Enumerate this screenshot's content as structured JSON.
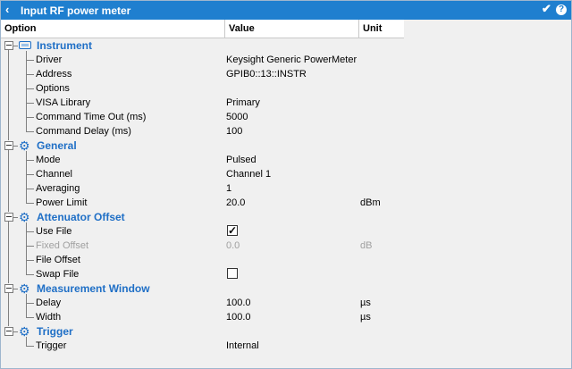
{
  "window": {
    "title": "Input RF power meter"
  },
  "columns": {
    "option": "Option",
    "value": "Value",
    "unit": "Unit"
  },
  "groups": [
    {
      "name": "Instrument",
      "icon": "instrument-icon",
      "rows": [
        {
          "label": "Driver",
          "value": "Keysight Generic PowerMeter",
          "unit": ""
        },
        {
          "label": "Address",
          "value": "GPIB0::13::INSTR",
          "unit": ""
        },
        {
          "label": "Options",
          "value": "",
          "unit": ""
        },
        {
          "label": "VISA Library",
          "value": "Primary",
          "unit": ""
        },
        {
          "label": "Command Time Out (ms)",
          "value": "5000",
          "unit": ""
        },
        {
          "label": "Command Delay (ms)",
          "value": "100",
          "unit": ""
        }
      ]
    },
    {
      "name": "General",
      "icon": "gear-icon",
      "rows": [
        {
          "label": "Mode",
          "value": "Pulsed",
          "unit": ""
        },
        {
          "label": "Channel",
          "value": "Channel 1",
          "unit": ""
        },
        {
          "label": "Averaging",
          "value": "1",
          "unit": ""
        },
        {
          "label": "Power Limit",
          "value": "20.0",
          "unit": "dBm"
        }
      ]
    },
    {
      "name": "Attenuator Offset",
      "icon": "gear-icon",
      "rows": [
        {
          "label": "Use File",
          "checkbox": true,
          "checked": true
        },
        {
          "label": "Fixed Offset",
          "value": "0.0",
          "unit": "dB",
          "disabled": true
        },
        {
          "label": "File Offset",
          "value": "",
          "unit": ""
        },
        {
          "label": "Swap File",
          "checkbox": true,
          "checked": false
        }
      ]
    },
    {
      "name": "Measurement Window",
      "icon": "gear-icon",
      "rows": [
        {
          "label": "Delay",
          "value": "100.0",
          "unit": "µs"
        },
        {
          "label": "Width",
          "value": "100.0",
          "unit": "µs"
        }
      ]
    },
    {
      "name": "Trigger",
      "icon": "gear-icon",
      "rows": [
        {
          "label": "Trigger",
          "value": "Internal",
          "unit": ""
        }
      ]
    }
  ]
}
